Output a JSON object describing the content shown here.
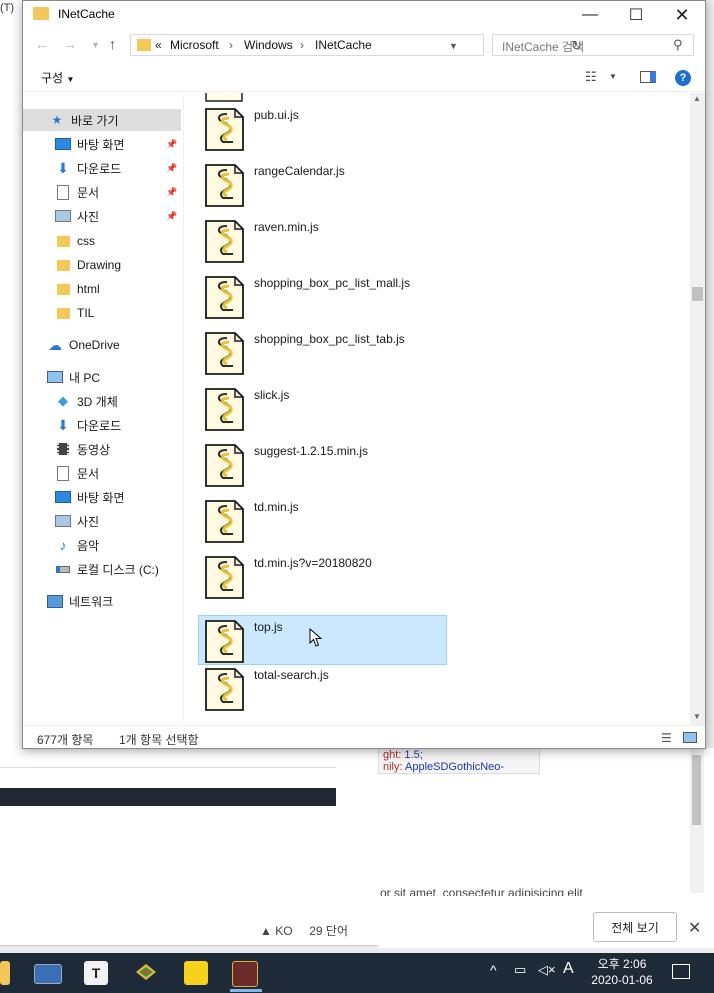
{
  "explorer": {
    "title": "INetCache",
    "address": {
      "overflow": "«",
      "crumbs": [
        "Microsoft",
        "Windows",
        "INetCache"
      ]
    },
    "search_placeholder": "INetCache 검색",
    "organize_label": "구성",
    "nav": [
      {
        "label": "바로 가기",
        "icon": "star-icon",
        "pinned": false
      },
      {
        "label": "바탕 화면",
        "icon": "desktop-icon",
        "pinned": true
      },
      {
        "label": "다운로드",
        "icon": "download-icon",
        "pinned": true
      },
      {
        "label": "문서",
        "icon": "document-icon",
        "pinned": true
      },
      {
        "label": "사진",
        "icon": "picture-icon",
        "pinned": true
      },
      {
        "label": "css",
        "icon": "folder-icon",
        "pinned": false
      },
      {
        "label": "Drawing",
        "icon": "folder-icon",
        "pinned": false
      },
      {
        "label": "html",
        "icon": "folder-icon",
        "pinned": false
      },
      {
        "label": "TIL",
        "icon": "folder-icon",
        "pinned": false
      },
      {
        "label": "OneDrive",
        "icon": "cloud-icon",
        "pinned": false
      },
      {
        "label": "내 PC",
        "icon": "computer-icon",
        "pinned": false
      },
      {
        "label": "3D 개체",
        "icon": "cube-icon",
        "pinned": false
      },
      {
        "label": "다운로드",
        "icon": "download-icon",
        "pinned": false
      },
      {
        "label": "동영상",
        "icon": "video-icon",
        "pinned": false
      },
      {
        "label": "문서",
        "icon": "document-icon",
        "pinned": false
      },
      {
        "label": "바탕 화면",
        "icon": "desktop-icon",
        "pinned": false
      },
      {
        "label": "사진",
        "icon": "picture-icon",
        "pinned": false
      },
      {
        "label": "음악",
        "icon": "music-icon",
        "pinned": false
      },
      {
        "label": "로컬 디스크 (C:)",
        "icon": "drive-icon",
        "pinned": false
      },
      {
        "label": "네트워크",
        "icon": "network-icon",
        "pinned": false
      }
    ],
    "files": [
      {
        "name": "pub.ui.js",
        "selected": false
      },
      {
        "name": "rangeCalendar.js",
        "selected": false
      },
      {
        "name": "raven.min.js",
        "selected": false
      },
      {
        "name": "shopping_box_pc_list_mall.js",
        "selected": false
      },
      {
        "name": "shopping_box_pc_list_tab.js",
        "selected": false
      },
      {
        "name": "slick.js",
        "selected": false
      },
      {
        "name": "suggest-1.2.15.min.js",
        "selected": false
      },
      {
        "name": "td.min.js",
        "selected": false
      },
      {
        "name": "td.min.js?v=20180820",
        "selected": false
      },
      {
        "name": "top.js",
        "selected": true
      },
      {
        "name": "total-search.js",
        "selected": false
      }
    ],
    "status": {
      "item_count": "677개 항목",
      "selected": "1개 항목 선택함"
    }
  },
  "background": {
    "left_title": "(T)",
    "code_line1_key": "ght:",
    "code_line1_val": "1.5;",
    "code_line2_key": "nily:",
    "code_line2_val": "AppleSDGothicNeo-",
    "lorem": "or sit amet, consectetur adipisicing elit",
    "lang": "KO",
    "word_count": "29 단어",
    "full_view_button": "전체 보기"
  },
  "taskbar": {
    "clock_period": "오후 2:06",
    "clock_date": "2020-01-06",
    "ime": "A"
  },
  "colors": {
    "selection": "#cce8ff",
    "selection_border": "#99d1ff",
    "taskbar": "#1f2a38",
    "folder": "#f3c75a",
    "help": "#1e6fd0"
  }
}
